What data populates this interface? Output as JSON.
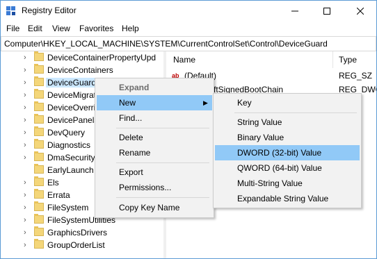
{
  "window": {
    "title": "Registry Editor"
  },
  "menubar": [
    "File",
    "Edit",
    "View",
    "Favorites",
    "Help"
  ],
  "address": "Computer\\HKEY_LOCAL_MACHINE\\SYSTEM\\CurrentControlSet\\Control\\DeviceGuard",
  "tree": {
    "items": [
      {
        "label": "DeviceContainerPropertyUpd"
      },
      {
        "label": "DeviceContainers"
      },
      {
        "label": "DeviceGuard"
      },
      {
        "label": "DeviceMigrat"
      },
      {
        "label": "DeviceOverri"
      },
      {
        "label": "DevicePanels"
      },
      {
        "label": "DevQuery"
      },
      {
        "label": "Diagnostics"
      },
      {
        "label": "DmaSecurity"
      },
      {
        "label": "EarlyLaunch"
      },
      {
        "label": "Els"
      },
      {
        "label": "Errata"
      },
      {
        "label": "FileSystem"
      },
      {
        "label": "FileSystemUtilities"
      },
      {
        "label": "GraphicsDrivers"
      },
      {
        "label": "GroupOrderList"
      }
    ]
  },
  "values": {
    "headers": {
      "name": "Name",
      "type": "Type"
    },
    "rows": [
      {
        "name": "(Default)",
        "type": "REG_SZ"
      },
      {
        "name": "MicrosoftSignedBootChain",
        "type": "REG_DWO"
      }
    ]
  },
  "context_menu": {
    "expand": "Expand",
    "new": "New",
    "find": "Find...",
    "delete": "Delete",
    "rename": "Rename",
    "export": "Export",
    "permissions": "Permissions...",
    "copy_key_name": "Copy Key Name"
  },
  "new_submenu": {
    "key": "Key",
    "string": "String Value",
    "binary": "Binary Value",
    "dword": "DWORD (32-bit) Value",
    "qword": "QWORD (64-bit) Value",
    "multi": "Multi-String Value",
    "expandable": "Expandable String Value"
  },
  "colors": {
    "highlight": "#91c9f7",
    "selection": "#cce8ff",
    "border": "#5b9bd5"
  }
}
